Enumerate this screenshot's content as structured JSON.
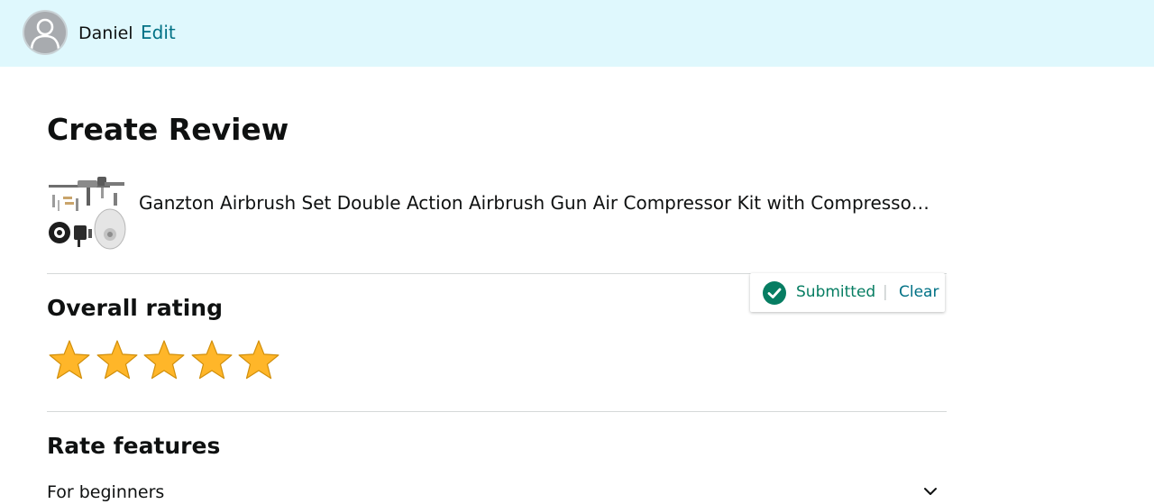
{
  "header": {
    "username": "Daniel",
    "edit_label": "Edit"
  },
  "page": {
    "title": "Create Review"
  },
  "product": {
    "title": "Ganzton Airbrush Set Double Action Airbrush Gun Air Compressor Kit with Compressor and Hose for Makeup, Cake Decorating, Model Painting"
  },
  "overall_rating": {
    "heading": "Overall rating",
    "rating": 5,
    "max": 5,
    "status_label": "Submitted",
    "status_separator": "|",
    "clear_label": "Clear",
    "star_color": "#ffb629",
    "star_stroke": "#d18f0b",
    "status_color": "#067d62"
  },
  "features": {
    "heading": "Rate features",
    "items": [
      {
        "label": "For beginners"
      }
    ]
  },
  "colors": {
    "header_bg": "#dff8fd",
    "link": "#007185",
    "divider": "#d5d9d9"
  }
}
